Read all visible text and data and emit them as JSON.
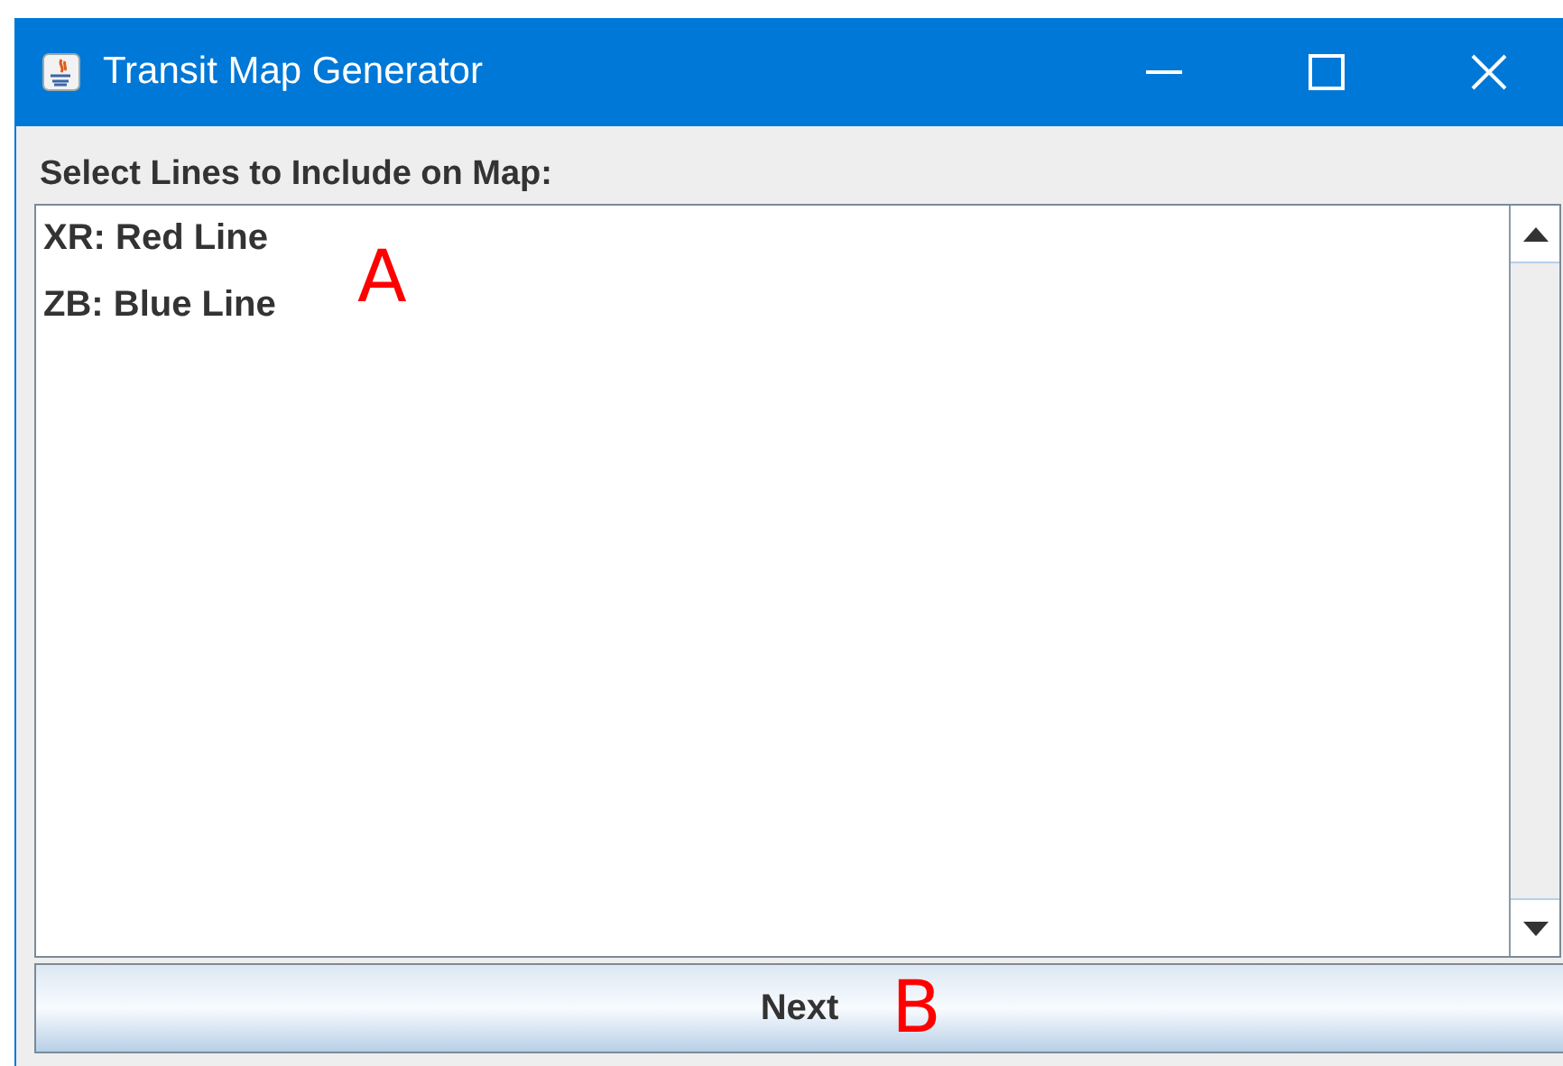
{
  "window": {
    "title": "Transit Map Generator"
  },
  "label": "Select Lines to Include on Map:",
  "list": {
    "items": [
      {
        "label": "XR: Red Line",
        "selected": false
      },
      {
        "label": "ZB: Blue Line",
        "selected": false
      }
    ],
    "annotation": "A"
  },
  "button": {
    "label": "Next",
    "annotation": "B"
  }
}
